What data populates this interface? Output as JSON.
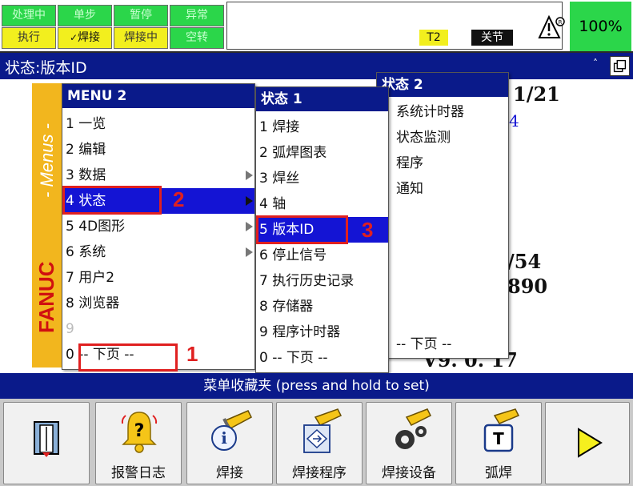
{
  "status_indicators": {
    "row1": [
      "处理中",
      "单步",
      "暂停",
      "异常"
    ],
    "row2": [
      "执行",
      "焊接",
      "焊接中",
      "空转"
    ]
  },
  "status_bar": {
    "mode": "T2",
    "state": "关节",
    "override": "100%"
  },
  "title": "状态:版本ID",
  "background_page": {
    "page_count": "1/21",
    "frag_4": "4",
    "frag_54": "/54",
    "frag_890": "890",
    "version": "V9. 0. 17"
  },
  "main_menu": {
    "header": "MENU  2",
    "items": [
      {
        "label": "1 一览",
        "submenu": false
      },
      {
        "label": "2 编辑",
        "submenu": false
      },
      {
        "label": "3 数据",
        "submenu": true
      },
      {
        "label": "4 状态",
        "submenu": true,
        "selected": true
      },
      {
        "label": "5 4D图形",
        "submenu": true
      },
      {
        "label": "6 系统",
        "submenu": true
      },
      {
        "label": "7 用户2",
        "submenu": false
      },
      {
        "label": "8 浏览器",
        "submenu": false
      },
      {
        "label": "9",
        "submenu": false,
        "dim": true
      },
      {
        "label": "0 -- 下页 --",
        "submenu": false
      }
    ]
  },
  "strip": {
    "menus": "- Menus -",
    "brand": "FANUC"
  },
  "status_menu_1": {
    "header": "状态  1",
    "items": [
      {
        "label": "1 焊接"
      },
      {
        "label": "2 弧焊图表"
      },
      {
        "label": "3 焊丝"
      },
      {
        "label": "4 轴"
      },
      {
        "label": "5 版本ID",
        "selected": true
      },
      {
        "label": "6 停止信号"
      },
      {
        "label": "7 执行历史记录"
      },
      {
        "label": "8 存储器"
      },
      {
        "label": "9 程序计时器"
      },
      {
        "label": "0 -- 下页 --"
      }
    ]
  },
  "status_menu_2": {
    "header": "状态  2",
    "items": [
      "系统计时器",
      "状态监测",
      "程序",
      "通知"
    ],
    "next_page": "-- 下页 --"
  },
  "annotations": [
    "1",
    "2",
    "3"
  ],
  "favorites_bar": "菜单收藏夹 (press and hold to set)",
  "function_keys": [
    {
      "label": "",
      "icon": "door-exit-icon"
    },
    {
      "label": "报警日志",
      "icon": "alarm-bell-icon"
    },
    {
      "label": "焊接",
      "icon": "weld-torch-info-icon"
    },
    {
      "label": "焊接程序",
      "icon": "weld-program-icon"
    },
    {
      "label": "焊接设备",
      "icon": "weld-equipment-icon"
    },
    {
      "label": "弧焊",
      "icon": "arc-weld-icon"
    },
    {
      "label": "",
      "icon": "next-arrow-icon"
    }
  ],
  "colors": {
    "title_blue": "#0a1a8a",
    "select_blue": "#1414d4",
    "green": "#2bd64a",
    "yellow": "#f2ef1e",
    "fanuc_yellow": "#f2b61e",
    "annotation_red": "#e02020"
  }
}
